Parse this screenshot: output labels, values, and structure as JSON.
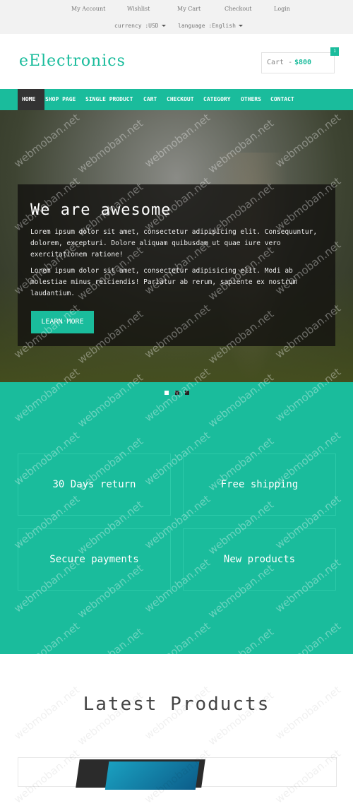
{
  "topbar": {
    "links": [
      "My Account",
      "Wishlist",
      "My Cart",
      "Checkout",
      "Login"
    ],
    "currency": "currency :USD",
    "language": "language :English"
  },
  "header": {
    "logo": "eElectronics",
    "cart_label": "Cart -",
    "cart_amount": "$800",
    "cart_count": "1"
  },
  "nav": {
    "items": [
      "HOME",
      "SHOP PAGE",
      "SINGLE PRODUCT",
      "CART",
      "CHECKOUT",
      "CATEGORY",
      "OTHERS",
      "CONTACT"
    ],
    "active": "HOME"
  },
  "hero": {
    "title": "We are awesome",
    "p1": "Lorem ipsum dolor sit amet, consectetur adipisicing elit. Consequuntur, dolorem, excepturi. Dolore aliquam quibusdam ut quae iure vero exercitationem ratione!",
    "p2": "Lorem ipsum dolor sit amet, consectetur adipisicing elit. Modi ab molestiae minus reiciendis! Pariatur ab rerum, sapiente ex nostrum laudantium.",
    "button": "LEARN MORE",
    "slides": 3,
    "active_slide": 1
  },
  "features": [
    "30 Days return",
    "Free shipping",
    "Secure payments",
    "New products"
  ],
  "latest": {
    "title": "Latest Products"
  },
  "watermark": "webmoban.net",
  "colors": {
    "accent": "#1abc9c",
    "dark": "#333333",
    "topbar": "#f2f2f2"
  }
}
